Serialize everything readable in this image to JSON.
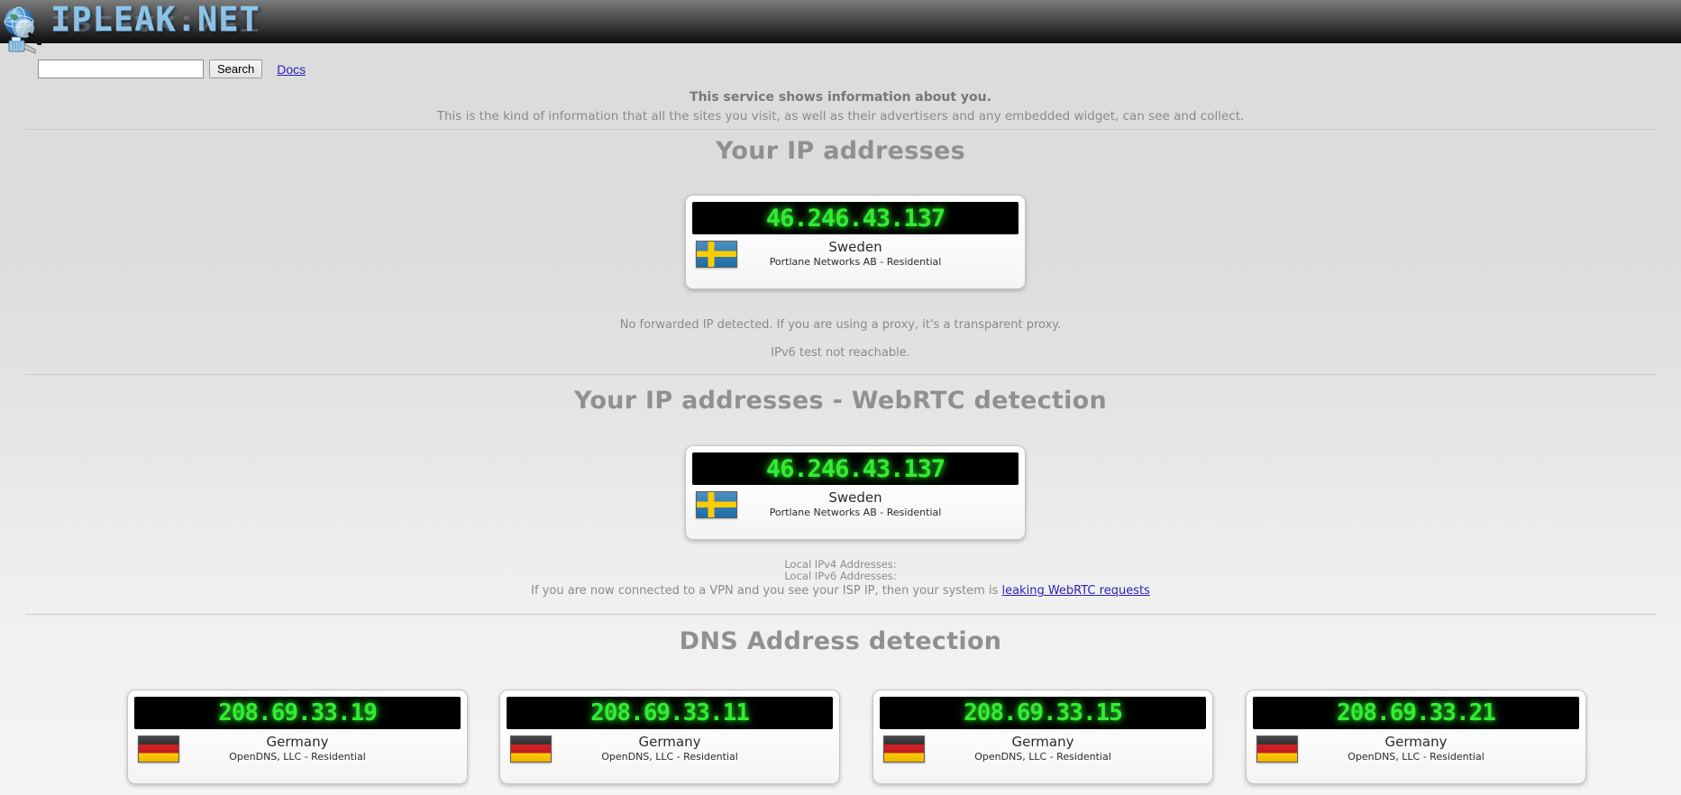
{
  "site": {
    "logo_text": "IPLEAK.NET",
    "logo_globe_icon": "globe-magnifier-icon",
    "logo_plug_icon": "ethernet-plug-icon"
  },
  "search": {
    "value": "",
    "placeholder": "",
    "button_label": "Search",
    "docs_label": "Docs"
  },
  "intro": {
    "line1": "This service shows information about you.",
    "line2": "This is the kind of information that all the sites you visit, as well as their advertisers and any embedded widget, can see and collect."
  },
  "sections": {
    "ip": {
      "title": "Your IP addresses",
      "card": {
        "ip": "46.246.43.137",
        "flag": "flag-sweden",
        "country": "Sweden",
        "isp": "Portlane Networks AB - Residential"
      },
      "note_forwarded": "No forwarded IP detected. If you are using a proxy, it's a transparent proxy.",
      "note_ipv6": "IPv6 test not reachable."
    },
    "webrtc": {
      "title": "Your IP addresses - WebRTC detection",
      "card": {
        "ip": "46.246.43.137",
        "flag": "flag-sweden",
        "country": "Sweden",
        "isp": "Portlane Networks AB - Residential"
      },
      "local_ipv4_label": "Local IPv4 Addresses:",
      "local_ipv6_label": "Local IPv6 Addresses:",
      "vpn_note_prefix": "If you are now connected to a VPN and you see your ISP IP, then your system is ",
      "vpn_note_link": "leaking WebRTC requests"
    },
    "dns": {
      "title": "DNS Address detection",
      "cards": [
        {
          "ip": "208.69.33.19",
          "flag": "flag-germany",
          "country": "Germany",
          "isp": "OpenDNS, LLC - Residential"
        },
        {
          "ip": "208.69.33.11",
          "flag": "flag-germany",
          "country": "Germany",
          "isp": "OpenDNS, LLC - Residential"
        },
        {
          "ip": "208.69.33.15",
          "flag": "flag-germany",
          "country": "Germany",
          "isp": "OpenDNS, LLC - Residential"
        },
        {
          "ip": "208.69.33.21",
          "flag": "flag-germany",
          "country": "Germany",
          "isp": "OpenDNS, LLC - Residential"
        }
      ]
    }
  },
  "colors": {
    "lcd_green": "#31ed31",
    "lcd_background": "#000000",
    "page_background": "#dcdcdc",
    "heading_gray": "#909090",
    "link_blue": "#2a1fb8"
  }
}
